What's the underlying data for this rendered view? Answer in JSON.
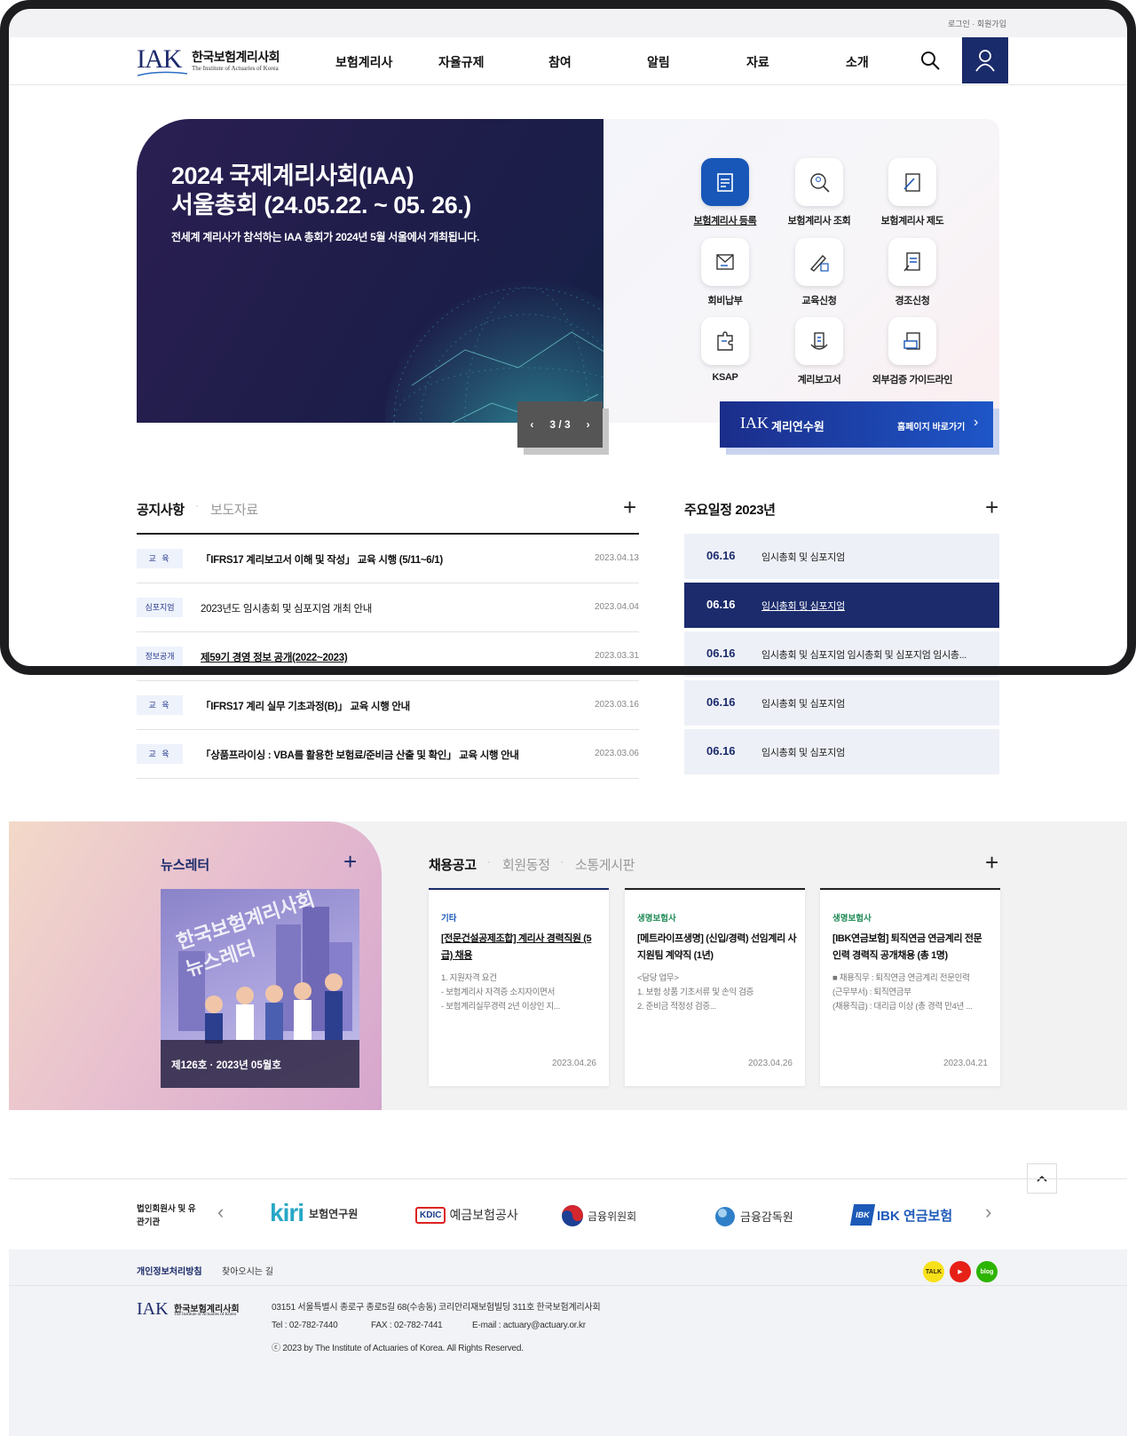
{
  "utility": {
    "login": "로그인",
    "separator": "·",
    "join": "회원가입"
  },
  "header": {
    "logo_mark": "IAK",
    "logo_ko": "한국보험계리사회",
    "logo_en": "The Institute of Actuaries of Korea",
    "menu": [
      "보험계리사",
      "자율규제",
      "참여",
      "알림",
      "자료",
      "소개"
    ]
  },
  "hero": {
    "title_line1": "2024 국제계리사회(IAA)",
    "title_line2": "서울총회 (24.05.22. ~ 05. 26.)",
    "subtitle": "전세계 계리사가 참석하는 IAA 총회가 2024년 5월 서울에서 개최됩니다.",
    "pager": "3 / 3"
  },
  "quick_menu": [
    {
      "label": "보험계리사 등록",
      "icon": "register-icon"
    },
    {
      "label": "보험계리사 조회",
      "icon": "search-person-icon"
    },
    {
      "label": "보험계리사 제도",
      "icon": "document-pen-icon"
    },
    {
      "label": "회비납부",
      "icon": "invoice-icon"
    },
    {
      "label": "교육신청",
      "icon": "edit-icon"
    },
    {
      "label": "경조신청",
      "icon": "form-icon"
    },
    {
      "label": "KSAP",
      "icon": "puzzle-icon"
    },
    {
      "label": "계리보고서",
      "icon": "report-icon"
    },
    {
      "label": "외부검증 가이드라인",
      "icon": "guide-icon"
    }
  ],
  "edu_banner": {
    "logo": "IAK",
    "title": "계리연수원",
    "link": "홈페이지 바로가기"
  },
  "notice": {
    "tab_active": "공지사항",
    "tab_inactive": "보도자료",
    "items": [
      {
        "badge": "교 육",
        "title": "「IFRS17 계리보고서 이해 및 작성」 교육 시행 (5/11~6/1)",
        "date": "2023.04.13"
      },
      {
        "badge": "심포지엄",
        "title": "2023년도 임시총회 및 심포지엄 개최 안내",
        "date": "2023.04.04"
      },
      {
        "badge": "정보공개",
        "title": "제59기 경영 정보 공개(2022~2023)",
        "date": "2023.03.31"
      },
      {
        "badge": "교 육",
        "title": "「IFRS17 계리 실무 기초과정(B)」 교육 시행 안내",
        "date": "2023.03.16"
      },
      {
        "badge": "교 육",
        "title": "「상품프라이싱 : VBA를 활용한 보험료/준비금 산출 및 확인」 교육 시행 안내",
        "date": "2023.03.06"
      }
    ]
  },
  "schedule": {
    "title": "주요일정 2023년",
    "items": [
      {
        "date": "06.16",
        "text": "임시총회 및 심포지엄"
      },
      {
        "date": "06.16",
        "text": "임시총회 및 심포지엄"
      },
      {
        "date": "06.16",
        "text": "임시총회 및 심포지엄 임시총회 및 심포지엄 임시총..."
      },
      {
        "date": "06.16",
        "text": "임시총회 및 심포지엄"
      },
      {
        "date": "06.16",
        "text": "임시총회 및 심포지엄"
      }
    ]
  },
  "newsletter": {
    "title": "뉴스레터",
    "cover_line1": "한국보험계리사회",
    "cover_line2": "뉴스레터",
    "issue": "제126호 · 2023년 05월호"
  },
  "board": {
    "tabs": [
      "채용공고",
      "회원동정",
      "소통게시판"
    ],
    "cards": [
      {
        "category": "기타",
        "title": "[전문건설공제조합] 계리사 경력직원 (5급) 채용",
        "body": "1. 지원자격 요건\n- 보험계리사 자격증 소지자이면서\n- 보험계리실무경력 2년 이상인 지...",
        "date": "2023.04.26"
      },
      {
        "category": "생명보험사",
        "title": "[메트라이프생명] (신입/경력) 선임계리 사지원팀 계약직 (1년)",
        "body": "<담당 업무>\n1. 보험 상품 기초서류 및 손익 검증\n2. 준비금 적정성 검증...",
        "date": "2023.04.26"
      },
      {
        "category": "생명보험사",
        "title": "[IBK연금보험] 퇴직연금 연금계리 전문 인력 경력직 공개채용 (총 1명)",
        "body": "■ 채용직무 : 퇴직연금 연금계리 전문인력\n(근무부서) : 퇴직연금부\n(채용직급) : 대리급 이상 (총 경력 만4년 ...",
        "date": "2023.04.21"
      }
    ]
  },
  "partners": {
    "label": "법인회원사 및 유관기관",
    "items": [
      {
        "name": "kiri",
        "text": "보험연구원"
      },
      {
        "name": "KDIC",
        "text": "예금보험공사"
      },
      {
        "name": "fsc",
        "text": "금융위원회"
      },
      {
        "name": "fss",
        "text": "금융감독원"
      },
      {
        "name": "IBK",
        "text": "IBK 연금보험"
      }
    ]
  },
  "footer": {
    "privacy": "개인정보처리방침",
    "directions": "찾아오시는 길",
    "address": "03151 서울특별시 종로구 종로5길 68(수송동) 코리안리재보험빌딩 311호 한국보험계리사회",
    "tel": "Tel : 02-782-7440",
    "fax": "FAX : 02-782-7441",
    "email": "E-mail : actuary@actuary.or.kr",
    "copyright": "ⓒ 2023 by The Institute of Actuaries of Korea. All Rights Reserved.",
    "sns": [
      "TALK",
      "▶",
      "blog"
    ]
  },
  "colors": {
    "navy": "#1b2b6b",
    "blue": "#1857b8",
    "green": "#1f8a56"
  }
}
